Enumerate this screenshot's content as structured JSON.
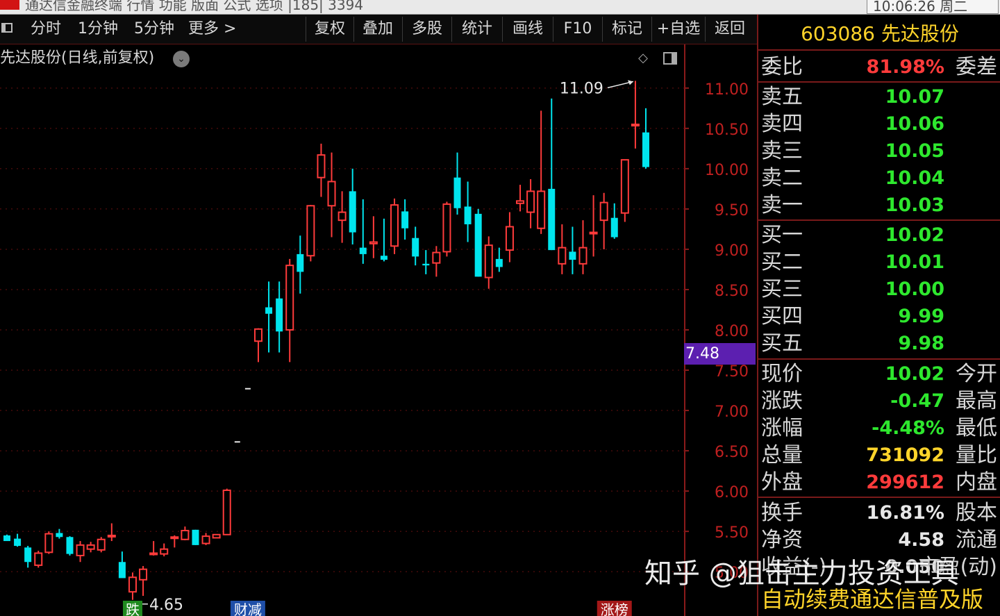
{
  "topbar": {
    "menu": "通达信金融终端   行情        功能   版面   公式   选项          |185|   3394",
    "clock": "10:06:26 周二"
  },
  "toolbar": {
    "periods": [
      "分时",
      "1分钟",
      "5分钟",
      "更多 >"
    ],
    "buttons": [
      "复权",
      "叠加",
      "多股",
      "统计",
      "画线",
      "F10",
      "标记",
      "+自选",
      "返回"
    ]
  },
  "chart": {
    "title": "先达股份(日线,前复权)",
    "high_label": "11.09",
    "low_label": "4.65",
    "current_price_badge": "7.48",
    "y_axis": [
      "11.00",
      "10.50",
      "10.00",
      "9.50",
      "9.00",
      "8.50",
      "8.00",
      "7.50",
      "7.00",
      "6.50",
      "6.00",
      "5.50",
      "5.00"
    ],
    "markers": [
      {
        "text": "跌",
        "color": "#1f8a1f"
      },
      {
        "text": "财减",
        "color": "#1f4fa8"
      },
      {
        "text": "涨榜",
        "color": "#a31818"
      }
    ]
  },
  "chart_data": {
    "type": "candlestick",
    "ylim": [
      4.45,
      11.55
    ],
    "y_ticks": [
      11.0,
      10.5,
      10.0,
      9.5,
      9.0,
      8.5,
      8.0,
      7.5,
      7.0,
      6.5,
      6.0,
      5.5,
      5.0
    ],
    "up_color": "#ff3b3b",
    "down_color": "#00e5ee",
    "candles": [
      {
        "o": 5.45,
        "h": 5.46,
        "l": 5.4,
        "c": 5.38
      },
      {
        "o": 5.41,
        "h": 5.47,
        "l": 5.31,
        "c": 5.32
      },
      {
        "o": 5.3,
        "h": 5.32,
        "l": 5.05,
        "c": 5.12
      },
      {
        "o": 5.08,
        "h": 5.26,
        "l": 5.05,
        "c": 5.23
      },
      {
        "o": 5.24,
        "h": 5.5,
        "l": 5.22,
        "c": 5.47
      },
      {
        "o": 5.48,
        "h": 5.53,
        "l": 5.41,
        "c": 5.43
      },
      {
        "o": 5.43,
        "h": 5.44,
        "l": 5.2,
        "c": 5.22
      },
      {
        "o": 5.2,
        "h": 5.38,
        "l": 5.12,
        "c": 5.33
      },
      {
        "o": 5.28,
        "h": 5.37,
        "l": 5.24,
        "c": 5.33
      },
      {
        "o": 5.27,
        "h": 5.43,
        "l": 5.24,
        "c": 5.4
      },
      {
        "o": 5.45,
        "h": 5.6,
        "l": 5.38,
        "c": 5.45
      },
      {
        "o": 5.12,
        "h": 5.25,
        "l": 4.98,
        "c": 4.92
      },
      {
        "o": 4.75,
        "h": 4.99,
        "l": 4.65,
        "c": 4.93
      },
      {
        "o": 4.9,
        "h": 5.07,
        "l": 4.7,
        "c": 5.03
      },
      {
        "o": 5.22,
        "h": 5.38,
        "l": 5.2,
        "c": 5.23
      },
      {
        "o": 5.22,
        "h": 5.35,
        "l": 5.19,
        "c": 5.28
      },
      {
        "o": 5.43,
        "h": 5.45,
        "l": 5.3,
        "c": 5.43
      },
      {
        "o": 5.4,
        "h": 5.56,
        "l": 5.39,
        "c": 5.51
      },
      {
        "o": 5.52,
        "h": 5.52,
        "l": 5.33,
        "c": 5.33
      },
      {
        "o": 5.35,
        "h": 5.48,
        "l": 5.33,
        "c": 5.44
      },
      {
        "o": 5.42,
        "h": 5.46,
        "l": 5.42,
        "c": 5.46
      },
      {
        "o": 5.46,
        "h": 6.03,
        "l": 5.46,
        "c": 6.01
      },
      {
        "o": 6.61,
        "h": 6.61,
        "l": 6.61,
        "c": 6.61
      },
      {
        "o": 7.27,
        "h": 7.27,
        "l": 7.27,
        "c": 7.27
      },
      {
        "o": 7.86,
        "h": 8.02,
        "l": 7.6,
        "c": 8.01
      },
      {
        "o": 8.28,
        "h": 8.6,
        "l": 7.72,
        "c": 8.2
      },
      {
        "o": 8.39,
        "h": 8.6,
        "l": 7.72,
        "c": 7.98
      },
      {
        "o": 8.0,
        "h": 8.88,
        "l": 7.6,
        "c": 8.8
      },
      {
        "o": 8.94,
        "h": 9.17,
        "l": 8.45,
        "c": 8.72
      },
      {
        "o": 8.92,
        "h": 9.55,
        "l": 8.85,
        "c": 9.54
      },
      {
        "o": 9.89,
        "h": 10.31,
        "l": 9.65,
        "c": 10.17
      },
      {
        "o": 9.54,
        "h": 10.2,
        "l": 9.15,
        "c": 9.84
      },
      {
        "o": 9.36,
        "h": 9.72,
        "l": 9.08,
        "c": 9.46
      },
      {
        "o": 9.72,
        "h": 10.0,
        "l": 9.06,
        "c": 9.21
      },
      {
        "o": 9.02,
        "h": 9.62,
        "l": 8.82,
        "c": 8.94
      },
      {
        "o": 9.07,
        "h": 9.41,
        "l": 8.89,
        "c": 9.09
      },
      {
        "o": 8.92,
        "h": 9.38,
        "l": 8.85,
        "c": 8.87
      },
      {
        "o": 9.04,
        "h": 9.63,
        "l": 8.94,
        "c": 9.55
      },
      {
        "o": 9.47,
        "h": 9.62,
        "l": 9.12,
        "c": 9.26
      },
      {
        "o": 9.14,
        "h": 9.28,
        "l": 8.8,
        "c": 8.91
      },
      {
        "o": 8.82,
        "h": 8.99,
        "l": 8.69,
        "c": 8.8
      },
      {
        "o": 8.83,
        "h": 9.04,
        "l": 8.66,
        "c": 8.96
      },
      {
        "o": 8.97,
        "h": 9.59,
        "l": 8.91,
        "c": 9.56
      },
      {
        "o": 9.89,
        "h": 10.2,
        "l": 9.43,
        "c": 9.51
      },
      {
        "o": 9.53,
        "h": 9.84,
        "l": 9.09,
        "c": 9.31
      },
      {
        "o": 9.44,
        "h": 9.5,
        "l": 8.66,
        "c": 8.66
      },
      {
        "o": 8.65,
        "h": 9.16,
        "l": 8.51,
        "c": 9.05
      },
      {
        "o": 8.88,
        "h": 9.02,
        "l": 8.72,
        "c": 8.78
      },
      {
        "o": 8.99,
        "h": 9.46,
        "l": 8.84,
        "c": 9.28
      },
      {
        "o": 9.57,
        "h": 9.8,
        "l": 9.47,
        "c": 9.6
      },
      {
        "o": 9.46,
        "h": 9.87,
        "l": 9.26,
        "c": 9.72
      },
      {
        "o": 9.26,
        "h": 10.72,
        "l": 9.19,
        "c": 9.72
      },
      {
        "o": 9.75,
        "h": 10.87,
        "l": 8.99,
        "c": 8.99
      },
      {
        "o": 8.82,
        "h": 9.31,
        "l": 8.69,
        "c": 9.02
      },
      {
        "o": 8.97,
        "h": 9.28,
        "l": 8.69,
        "c": 8.87
      },
      {
        "o": 8.82,
        "h": 9.36,
        "l": 8.69,
        "c": 9.02
      },
      {
        "o": 9.21,
        "h": 9.67,
        "l": 8.91,
        "c": 9.21
      },
      {
        "o": 9.36,
        "h": 9.7,
        "l": 9.0,
        "c": 9.58
      },
      {
        "o": 9.39,
        "h": 9.57,
        "l": 9.13,
        "c": 9.15
      },
      {
        "o": 9.45,
        "h": 10.1,
        "l": 9.34,
        "c": 10.11
      },
      {
        "o": 10.55,
        "h": 11.09,
        "l": 10.25,
        "c": 10.55
      },
      {
        "o": 10.45,
        "h": 10.75,
        "l": 10.0,
        "c": 10.02
      }
    ]
  },
  "quote": {
    "code_name": "603086 先达股份",
    "weibi": {
      "label": "委比",
      "value": "81.98%",
      "label2": "委差",
      "color": "#ff3b3b"
    },
    "sells": [
      {
        "label": "卖五",
        "value": "10.07"
      },
      {
        "label": "卖四",
        "value": "10.06"
      },
      {
        "label": "卖三",
        "value": "10.05"
      },
      {
        "label": "卖二",
        "value": "10.04"
      },
      {
        "label": "卖一",
        "value": "10.03"
      }
    ],
    "buys": [
      {
        "label": "买一",
        "value": "10.02"
      },
      {
        "label": "买二",
        "value": "10.01"
      },
      {
        "label": "买三",
        "value": "10.00"
      },
      {
        "label": "买四",
        "value": "9.99"
      },
      {
        "label": "买五",
        "value": "9.98"
      }
    ],
    "stats": [
      {
        "label": "现价",
        "value": "10.02",
        "label2": "今开",
        "color": "#2ee82e"
      },
      {
        "label": "涨跌",
        "value": "-0.47",
        "label2": "最高",
        "color": "#2ee82e"
      },
      {
        "label": "涨幅",
        "value": "-4.48%",
        "label2": "最低",
        "color": "#2ee82e"
      },
      {
        "label": "总量",
        "value": "731092",
        "label2": "量比",
        "color": "#ffd42a"
      },
      {
        "label": "外盘",
        "value": "299612",
        "label2": "内盘",
        "color": "#ff3b3b"
      }
    ],
    "stats2": [
      {
        "label": "换手",
        "value": "16.81%",
        "label2": "股本",
        "color": "#e8e8e8"
      },
      {
        "label": "净资",
        "value": "4.58",
        "label2": "流通",
        "color": "#e8e8e8"
      },
      {
        "label": "收益(-)",
        "value": "0.050",
        "label2": "市盈(动)",
        "color": "#e8e8e8"
      }
    ],
    "footer": "自动续费通达信普及版"
  },
  "watermark": "知乎 @狙击主力投资工具"
}
